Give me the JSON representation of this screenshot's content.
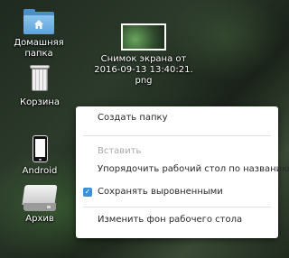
{
  "desktop": {
    "items": [
      {
        "label": "Домашняя папка",
        "icon": "home-folder-icon"
      },
      {
        "label": "Корзина",
        "icon": "trash-icon"
      },
      {
        "label": "Android",
        "icon": "phone-icon"
      },
      {
        "label": "Архив",
        "icon": "drive-icon"
      },
      {
        "label_lines": [
          "Снимок экрана от",
          "2016-09-13 13:40:21.",
          "png"
        ],
        "icon": "image-thumbnail-icon"
      }
    ]
  },
  "context_menu": {
    "items": [
      {
        "label": "Создать папку",
        "enabled": true
      },
      {
        "label": "Вставить",
        "enabled": false
      },
      {
        "label": "Упорядочить рабочий стол по названию",
        "enabled": true
      },
      {
        "label": "Сохранять выровненными",
        "enabled": true,
        "checked": true
      },
      {
        "label": "Изменить фон рабочего стола",
        "enabled": true
      }
    ],
    "check_color": "#3d8fd6"
  }
}
